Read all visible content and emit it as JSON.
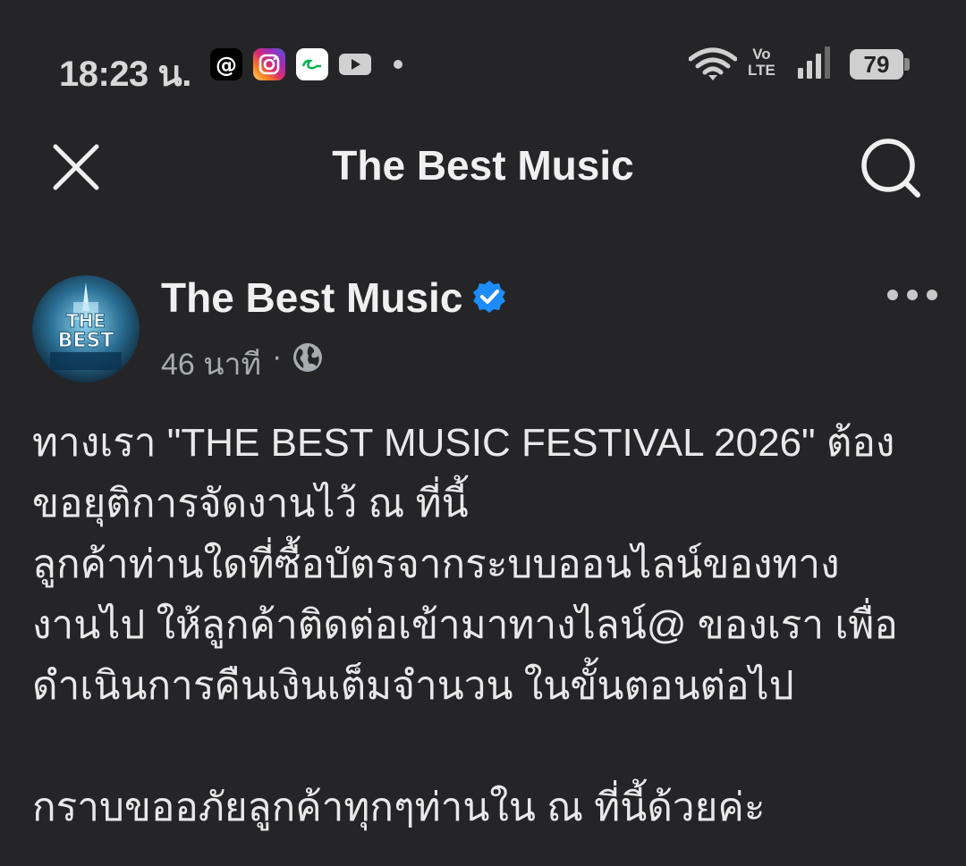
{
  "status_bar": {
    "time": "18:23 น.",
    "battery": "79",
    "network": "Vo\nLTE",
    "notification_icons": [
      "threads-icon",
      "instagram-icon",
      "grab-icon",
      "youtube-icon"
    ]
  },
  "header": {
    "title": "The Best Music",
    "close_icon": "close-icon",
    "search_icon": "search-icon"
  },
  "post": {
    "page_name": "The Best Music",
    "verified": true,
    "time_ago": "46 นาที",
    "separator": "·",
    "audience_icon": "globe-icon",
    "avatar_text": "THE BEST",
    "lines": [
      "ทางเรา \"THE BEST MUSIC FESTIVAL 2026\" ต้อง",
      "ขอยุติการจัดงานไว้ ณ ที่นี้",
      "ลูกค้าท่านใดที่ซื้อบัตรจากระบบออนไลน์ของทาง",
      "งานไป ให้ลูกค้าติดต่อเข้ามาทางไลน์@ ของเรา เพื่อ",
      "ดำเนินการคืนเงินเต็มจำนวน ในขั้นตอนต่อไป",
      "",
      "กราบขออภัยลูกค้าทุกๆท่านใน ณ ที่นี้ด้วยค่ะ"
    ]
  },
  "colors": {
    "background": "#252527",
    "text_primary": "#f0f0f0",
    "text_secondary": "#a8abaf",
    "verified_blue": "#1d8cf8"
  }
}
